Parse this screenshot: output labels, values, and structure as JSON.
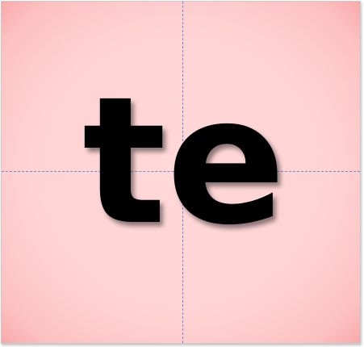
{
  "card": {
    "text": "te",
    "background": "#ffd3d3",
    "guide_color": "#6f86d6",
    "text_color": "#000000"
  }
}
